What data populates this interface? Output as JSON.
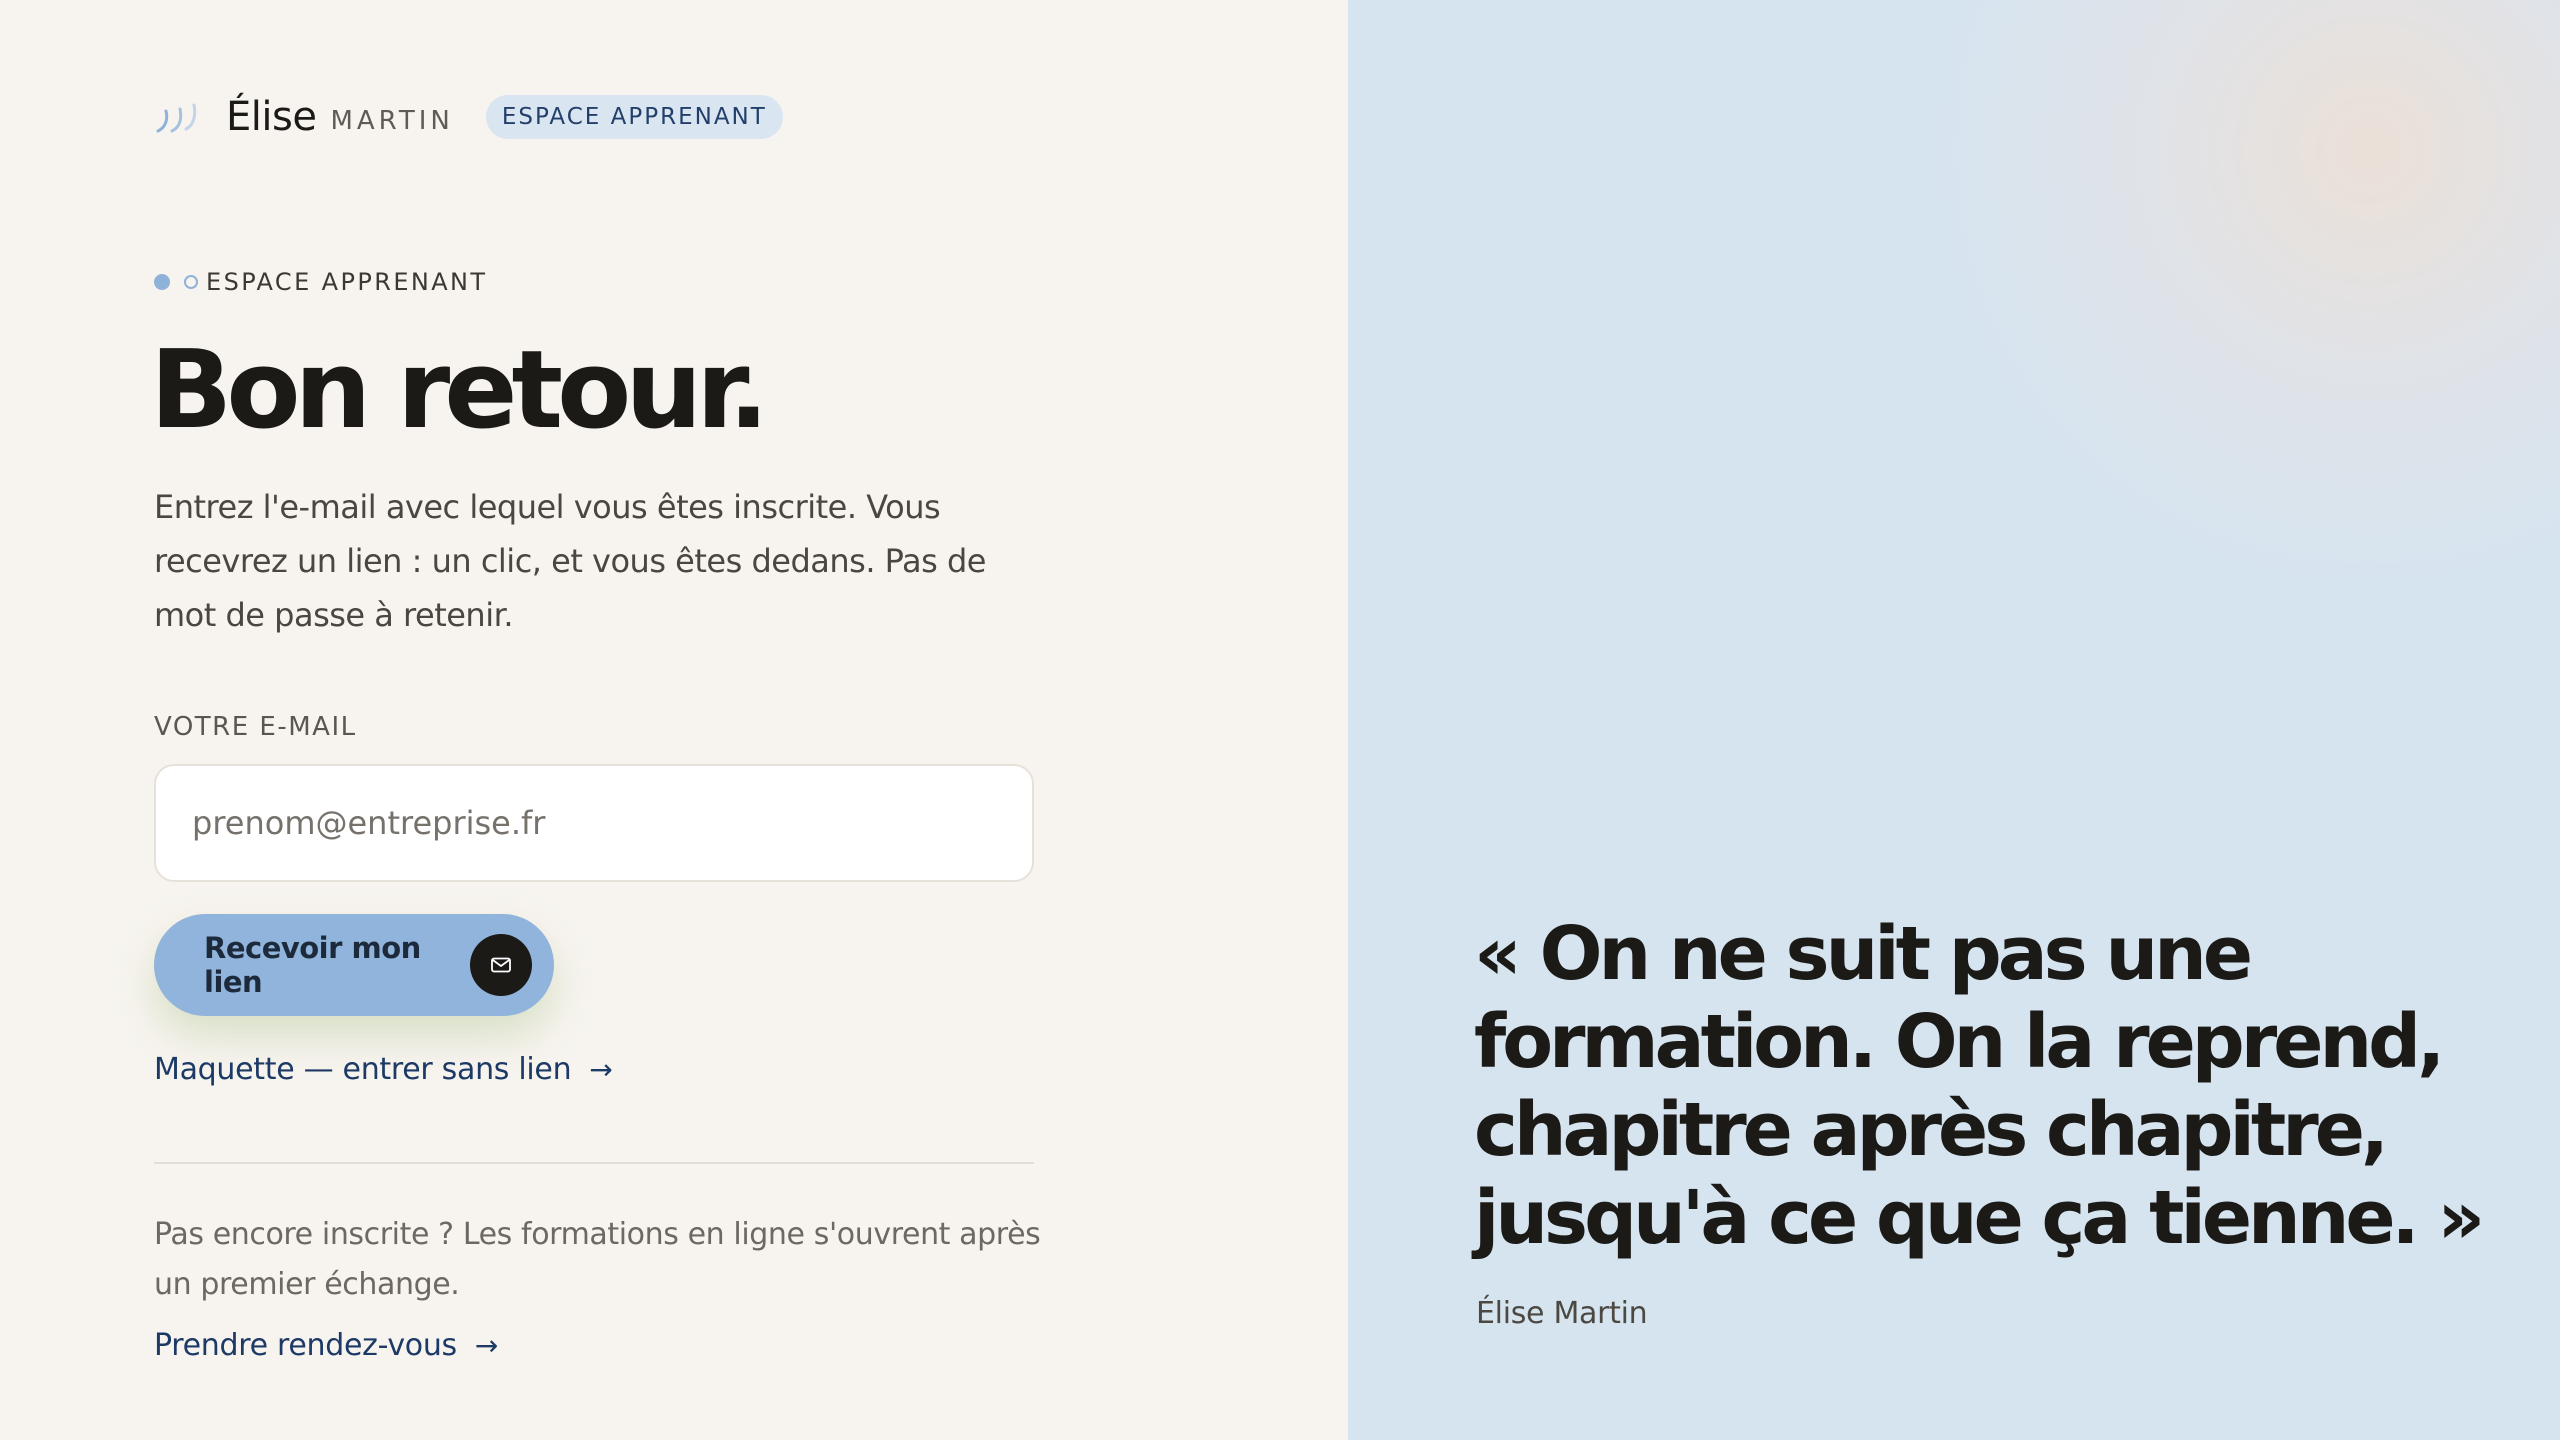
{
  "header": {
    "brand_first": "Élise",
    "brand_last": "MARTIN",
    "badge": "ESPACE APPRENANT"
  },
  "main": {
    "eyebrow": "ESPACE APPRENANT",
    "title": "Bon retour.",
    "intro": "Entrez l'e-mail avec lequel vous êtes inscrite. Vous recevrez un lien : un clic, et vous êtes dedans. Pas de mot de passe à retenir.",
    "email_label": "VOTRE E-MAIL",
    "email_value": "",
    "email_placeholder": "prenom@entreprise.fr",
    "submit_label": "Recevoir mon lien",
    "demo_link": "Maquette — entrer sans lien",
    "arrow": "→",
    "signup_note": "Pas encore inscrite ? Les formations en ligne s'ouvrent après un premier échange.",
    "appointment_link": "Prendre rendez-vous"
  },
  "aside": {
    "quote": "« On ne suit pas une formation. On la reprend, chapitre après chapitre, jusqu'à ce que ça tienne. »",
    "author": "Élise Martin"
  },
  "icons": {
    "brand": "waves-logo-icon",
    "submit": "mail-icon",
    "link": "arrow-right-icon"
  },
  "colors": {
    "page_bg": "#f7f4ef",
    "panel_bg": "#d6e4f0",
    "accent": "#90b4db",
    "link": "#1d3a66",
    "text": "#1c1a17"
  }
}
